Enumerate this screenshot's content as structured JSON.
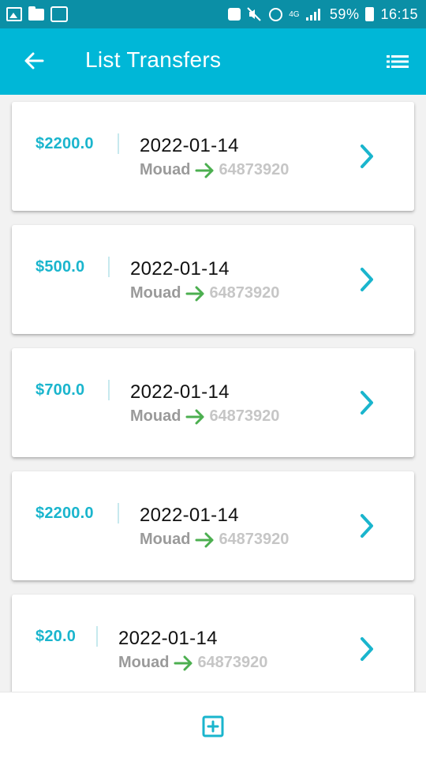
{
  "status_bar": {
    "battery": "59%",
    "time": "16:15",
    "network": "4G"
  },
  "app_bar": {
    "title": "List Transfers",
    "back_icon": "arrow-left-icon",
    "menu_icon": "list-menu-icon"
  },
  "colors": {
    "app_bar": "#00b7d7",
    "status_bar": "#0b8fa6",
    "amount": "#1ab5cd",
    "arrow": "#4caf50"
  },
  "transfers": [
    {
      "amount": "$2200.0",
      "date": "2022-01-14",
      "sender": "Mouad",
      "receiver": "64873920"
    },
    {
      "amount": "$500.0",
      "date": "2022-01-14",
      "sender": "Mouad",
      "receiver": "64873920"
    },
    {
      "amount": "$700.0",
      "date": "2022-01-14",
      "sender": "Mouad",
      "receiver": "64873920"
    },
    {
      "amount": "$2200.0",
      "date": "2022-01-14",
      "sender": "Mouad",
      "receiver": "64873920"
    },
    {
      "amount": "$20.0",
      "date": "2022-01-14",
      "sender": "Mouad",
      "receiver": "64873920"
    }
  ],
  "bottom_bar": {
    "add_icon": "add-box-icon"
  }
}
